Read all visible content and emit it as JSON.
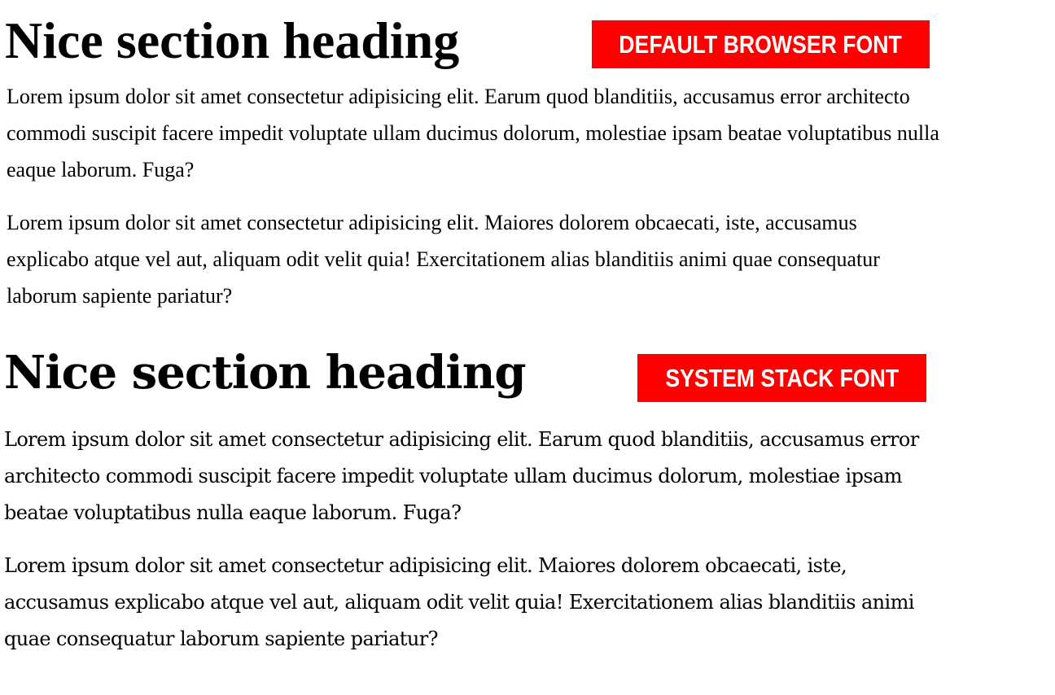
{
  "sections": [
    {
      "heading": "Nice section heading",
      "badge": "DEFAULT BROWSER FONT",
      "paragraphs": [
        "Lorem ipsum dolor sit amet consectetur adipisicing elit. Earum quod blanditiis, accusamus error architecto commodi suscipit facere impedit voluptate ullam ducimus dolorum, molestiae ipsam beatae voluptatibus nulla eaque laborum. Fuga?",
        "Lorem ipsum dolor sit amet consectetur adipisicing elit. Maiores dolorem obcaecati, iste, accusamus explicabo atque vel aut, aliquam odit velit quia! Exercitationem alias blanditiis animi quae consequatur laborum sapiente pariatur?"
      ]
    },
    {
      "heading": "Nice section heading",
      "badge": "SYSTEM STACK FONT",
      "paragraphs": [
        "Lorem ipsum dolor sit amet consectetur adipisicing elit. Earum quod blanditiis, accusamus error architecto commodi suscipit facere impedit voluptate ullam ducimus dolorum, molestiae ipsam beatae voluptatibus nulla eaque laborum. Fuga?",
        "Lorem ipsum dolor sit amet consectetur adipisicing elit. Maiores dolorem obcaecati, iste, accusamus explicabo atque vel aut, aliquam odit velit quia! Exercitationem alias blanditiis animi quae consequatur laborum sapiente pariatur?"
      ]
    }
  ],
  "colors": {
    "badge_background": "#ff0000",
    "badge_text": "#ffffff",
    "text": "#000000",
    "background": "#ffffff"
  }
}
